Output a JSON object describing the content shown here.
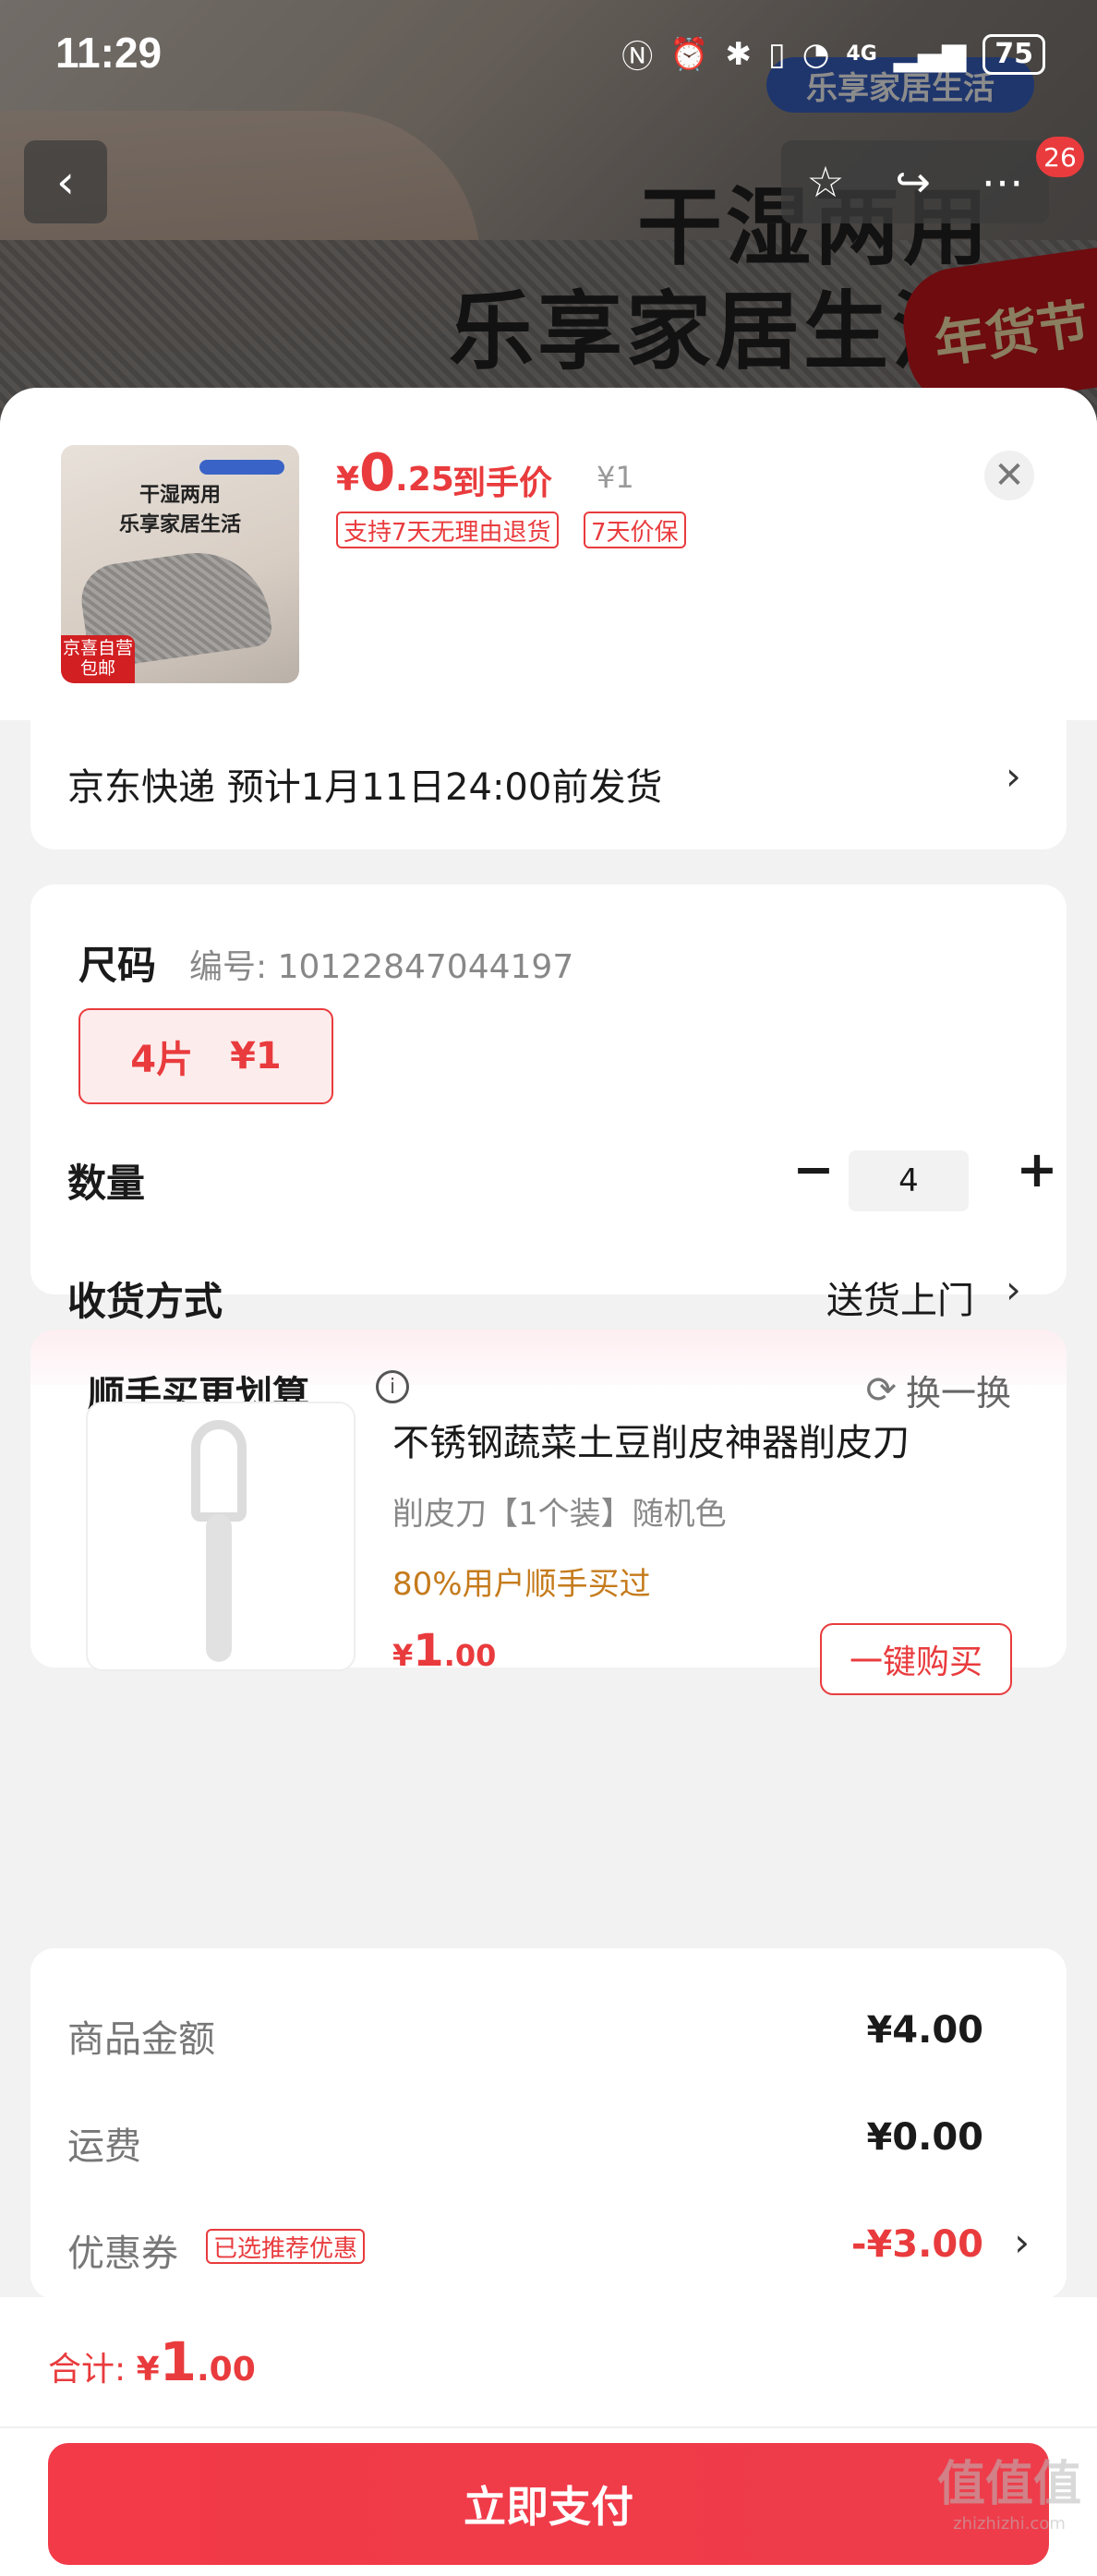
{
  "status_bar": {
    "time": "11:29",
    "network": "4G",
    "battery": "75"
  },
  "background": {
    "tag": "乐享家居生活",
    "title_line1": "干湿两用",
    "title_line2": "乐享家居生活",
    "badge": "年货节",
    "cart_count": "26"
  },
  "product": {
    "thumb_title1": "干湿两用",
    "thumb_title2": "乐享家居生活",
    "thumb_label_line1": "京喜自营",
    "thumb_label_line2": "包邮",
    "price_symbol": "¥",
    "price_int": "0",
    "price_dec": ".25",
    "price_label": "到手价",
    "original_price": "¥1",
    "chips": [
      "支持7天无理由退货",
      "7天价保"
    ]
  },
  "shipping": {
    "text": "京东快递 预计1月11日24:00前发货"
  },
  "spec": {
    "heading": "尺码",
    "sku": "编号: 10122847044197",
    "option_name": "4片",
    "option_price": "¥1",
    "quantity_label": "数量",
    "quantity_value": "4",
    "delivery_label": "收货方式",
    "delivery_value": "送货上门"
  },
  "upsell": {
    "heading": "顺手买更划算",
    "swap_label": "换一换",
    "title": "不锈钢蔬菜土豆削皮神器削皮刀",
    "subtitle": "削皮刀【1个装】随机色",
    "percent": "80%用户顺手买过",
    "price_symbol": "¥",
    "price_int": "1",
    "price_dec": ".00",
    "buy_label": "一键购买"
  },
  "summary": {
    "rows": [
      {
        "label": "商品金额",
        "value": "¥4.00"
      },
      {
        "label": "运费",
        "value": "¥0.00"
      },
      {
        "label": "优惠券",
        "value": "-¥3.00",
        "tag": "已选推荐优惠"
      }
    ]
  },
  "footer": {
    "total_label": "合计: ",
    "total_symbol": "¥",
    "total_int": "1",
    "total_dec": ".00",
    "pay_label": "立即支付"
  },
  "watermark": {
    "line1": "值值值",
    "line2": "zhizhizhi.com"
  },
  "colors": {
    "accent": "#e93b3d",
    "pay_button": "#f23a48",
    "gold": "#c57b1c"
  },
  "icons": [
    "back-icon",
    "star-icon",
    "share-icon",
    "more-icon",
    "close-icon",
    "chevron-right-icon",
    "info-icon",
    "refresh-icon",
    "minus-icon",
    "plus-icon"
  ]
}
